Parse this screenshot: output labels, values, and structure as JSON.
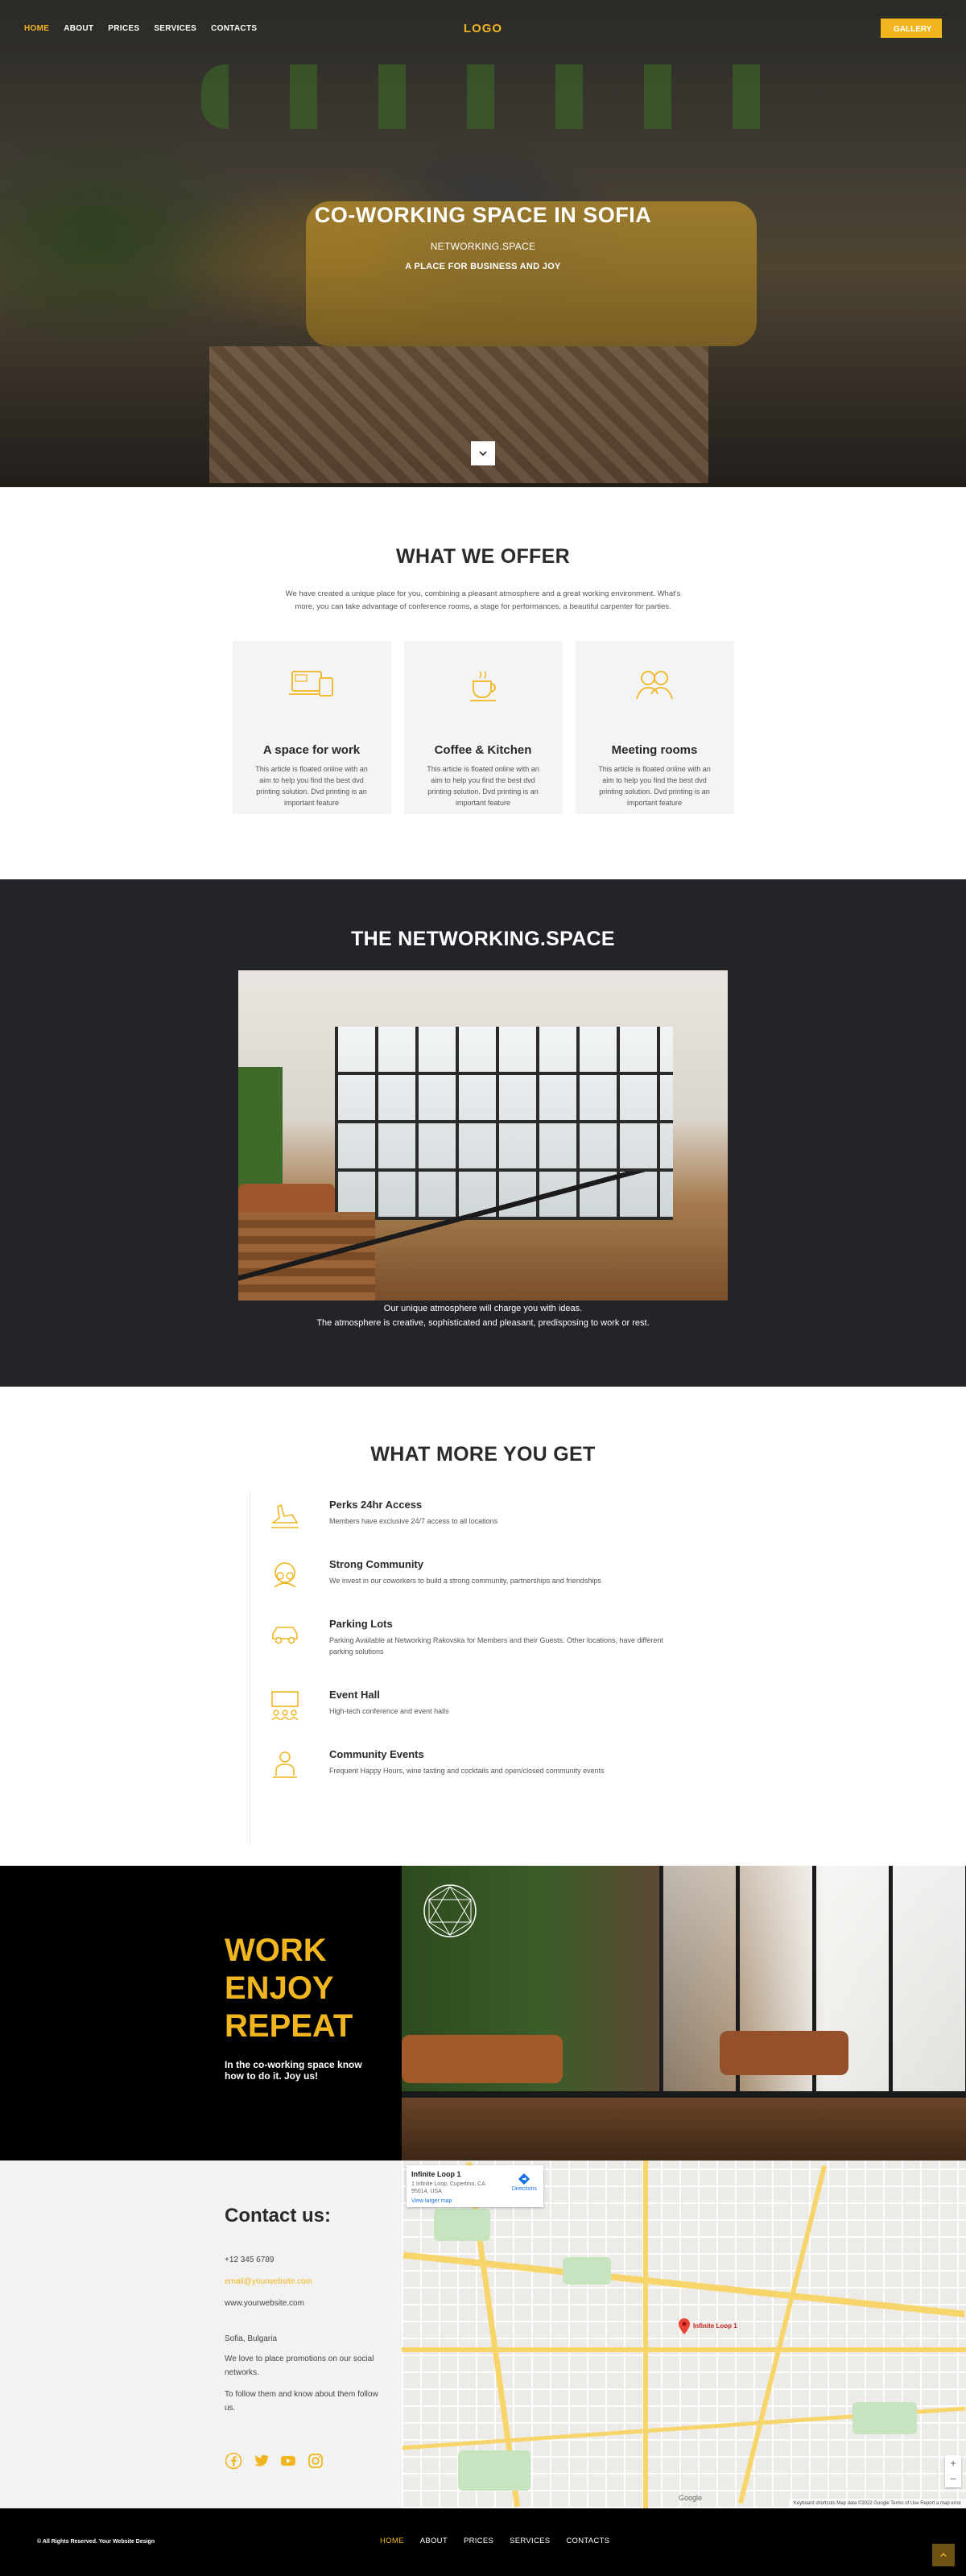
{
  "nav": {
    "items": [
      {
        "label": "HOME",
        "active": true
      },
      {
        "label": "ABOUT",
        "active": false
      },
      {
        "label": "PRICES",
        "active": false
      },
      {
        "label": "SERVICES",
        "active": false
      },
      {
        "label": "CONTACTS",
        "active": false
      }
    ],
    "logo": "LOGO",
    "gallery_label": "GALLERY"
  },
  "hero": {
    "title": "CO-WORKING SPACE IN SOFIA",
    "subtitle": "NETWORKING.SPACE",
    "tagline": "A PLACE FOR BUSINESS AND JOY",
    "scroll_icon": "chevron-down-icon"
  },
  "offer": {
    "title": "WHAT WE OFFER",
    "intro": "We have created a unique place for you, combining a pleasant atmosphere and a great working environment. What's more, you can take advantage of conference rooms, a stage for performances, a beautiful carpenter for parties.",
    "cards": [
      {
        "icon": "devices-icon",
        "title": "A space for work",
        "text": "This article is floated online with an aim to help you find the best dvd printing solution. Dvd printing is an important feature"
      },
      {
        "icon": "coffee-cup-icon",
        "title": "Coffee & Kitchen",
        "text": "This article is floated online with an aim to help you find the best dvd printing solution. Dvd printing is an important feature"
      },
      {
        "icon": "people-chat-icon",
        "title": "Meeting rooms",
        "text": "This article is floated online with an aim to help you find the best dvd printing solution. Dvd printing is an important feature"
      }
    ]
  },
  "networking": {
    "title": "THE NETWORKING.SPACE",
    "caption_1": "Our unique atmosphere will charge you with ideas.",
    "caption_2": "The atmosphere is creative, sophisticated and pleasant, predisposing to work or rest."
  },
  "more": {
    "title": "WHAT MORE YOU GET",
    "features": [
      {
        "icon": "plane-icon",
        "title": "Perks 24hr Access",
        "text": "Members have exclusive 24/7 access to all locations"
      },
      {
        "icon": "community-icon",
        "title": "Strong Community",
        "text": "We invest in our coworkers to build a strong community, partnerships and friendships"
      },
      {
        "icon": "car-icon",
        "title": "Parking Lots",
        "text": "Parking Available at Networking Rakovska for Members and their Guests. Other locations, have different parking solutions"
      },
      {
        "icon": "event-hall-icon",
        "title": "Event Hall",
        "text": "High-tech conference and event halls"
      },
      {
        "icon": "person-event-icon",
        "title": "Community Events",
        "text": "Frequent Happy Hours, wine tasting and cocktails and open/closed community events"
      }
    ]
  },
  "wer": {
    "line1": "WORK",
    "line2": "ENJOY",
    "line3": "REPEAT",
    "slogan": "In the co-working space know how to do it. Joy us!"
  },
  "contact": {
    "title": "Contact us:",
    "phone": "+12 345 6789",
    "email": "email@yourwebsite.com",
    "website": "www.yourwebsite.com",
    "address": "Sofia, Bulgaria",
    "promo": "We love to place promotions on our social networks.",
    "follow": "To follow them and know about them follow us.",
    "socials": [
      "facebook-icon",
      "twitter-icon",
      "youtube-icon",
      "instagram-icon"
    ]
  },
  "map": {
    "place": "Infinite Loop 1",
    "address": "1 Infinite Loop, Cupertino, CA 95014, USA",
    "view_larger": "View larger map",
    "directions": "Directions",
    "pin_label": "Infinite Loop 1",
    "footer": "Keyboard shortcuts   Map data ©2022 Google   Terms of Use   Report a map error",
    "google": "Google"
  },
  "footer": {
    "rights": "© All Rights Reserved. Your Website Design",
    "items": [
      {
        "label": "HOME",
        "active": true
      },
      {
        "label": "ABOUT",
        "active": false
      },
      {
        "label": "PRICES",
        "active": false
      },
      {
        "label": "SERVICES",
        "active": false
      },
      {
        "label": "CONTACTS",
        "active": false
      }
    ],
    "totop_icon": "arrow-up-icon"
  },
  "colors": {
    "accent": "#f1b61f",
    "dark": "#222429",
    "black": "#000000"
  }
}
